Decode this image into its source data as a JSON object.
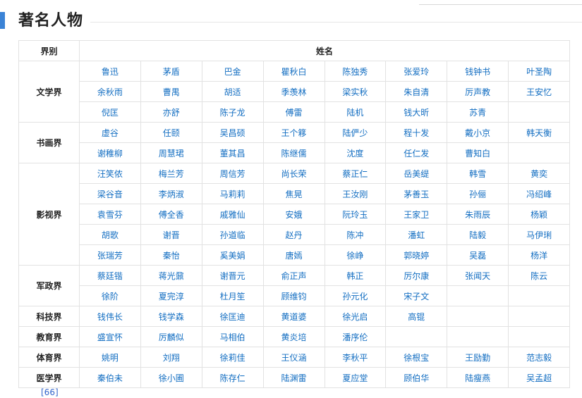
{
  "section": {
    "title": "著名人物"
  },
  "table": {
    "headers": [
      "界别",
      "姓名"
    ],
    "categories": [
      {
        "name": "文学界",
        "rows": [
          [
            "鲁迅",
            "茅盾",
            "巴金",
            "瞿秋白",
            "陈独秀",
            "张爱玲",
            "钱钟书",
            "叶圣陶"
          ],
          [
            "余秋雨",
            "曹禺",
            "胡适",
            "季羡林",
            "梁实秋",
            "朱自清",
            "厉声教",
            "王安忆"
          ],
          [
            "倪匡",
            "亦舒",
            "陈子龙",
            "傅雷",
            "陆机",
            "钱大昕",
            "苏青",
            ""
          ]
        ]
      },
      {
        "name": "书画界",
        "rows": [
          [
            "虚谷",
            "任颐",
            "吴昌硕",
            "王个簃",
            "陆俨少",
            "程十发",
            "戴小京",
            "韩天衡"
          ],
          [
            "谢稚柳",
            "周慧珺",
            "董其昌",
            "陈继儒",
            "沈度",
            "任仁发",
            "曹知白",
            ""
          ]
        ]
      },
      {
        "name": "影视界",
        "rows": [
          [
            "汪笑侬",
            "梅兰芳",
            "周信芳",
            "尚长荣",
            "蔡正仁",
            "岳美缇",
            "韩雪",
            "黄奕"
          ],
          [
            "梁谷音",
            "李炳淑",
            "马莉莉",
            "焦晃",
            "王汝刚",
            "茅善玉",
            "孙俪",
            "冯绍峰"
          ],
          [
            "袁雪芬",
            "傅全香",
            "戚雅仙",
            "安娥",
            "阮玲玉",
            "王家卫",
            "朱雨辰",
            "杨颖"
          ],
          [
            "胡歌",
            "谢晋",
            "孙道临",
            "赵丹",
            "陈冲",
            "潘虹",
            "陆毅",
            "马伊琍"
          ],
          [
            "张瑞芳",
            "秦怡",
            "奚美娟",
            "唐嫣",
            "徐峥",
            "郭晓婷",
            "吴磊",
            "杨洋"
          ]
        ]
      },
      {
        "name": "军政界",
        "rows": [
          [
            "蔡廷锴",
            "蒋光鼐",
            "谢晋元",
            "俞正声",
            "韩正",
            "厉尔康",
            "张闻天",
            "陈云"
          ],
          [
            "徐阶",
            "夏完淳",
            "杜月笙",
            "顾维钧",
            "孙元化",
            "宋子文",
            "",
            ""
          ]
        ]
      },
      {
        "name": "科技界",
        "rows": [
          [
            "钱伟长",
            "钱学森",
            "徐匡迪",
            "黄道婆",
            "徐光启",
            "高锟",
            "",
            ""
          ]
        ]
      },
      {
        "name": "教育界",
        "rows": [
          [
            "盛宣怀",
            "厉麟似",
            "马相伯",
            "黄炎培",
            "潘序伦",
            "",
            "",
            ""
          ]
        ]
      },
      {
        "name": "体育界",
        "rows": [
          [
            "姚明",
            "刘翔",
            "徐莉佳",
            "王仪涵",
            "李秋平",
            "徐根宝",
            "王励勤",
            "范志毅"
          ]
        ]
      },
      {
        "name": "医学界",
        "rows": [
          [
            "秦伯未",
            "徐小圃",
            "陈存仁",
            "陆渊雷",
            "夏应堂",
            "顾伯华",
            "陆瘦燕",
            "吴孟超"
          ]
        ]
      }
    ]
  },
  "footnote": "[66]",
  "colors": {
    "accent": "#3b83d6",
    "link": "#136ec2",
    "border": "#e2e2e2"
  }
}
